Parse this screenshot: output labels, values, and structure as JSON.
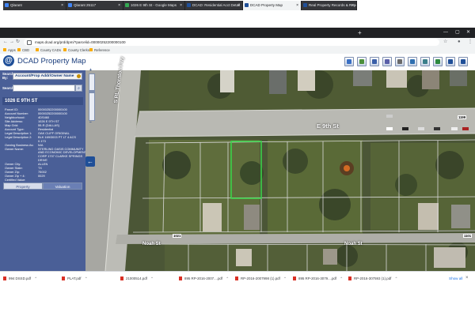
{
  "browser": {
    "tabs": [
      {
        "label": "Qlarant",
        "color": "#4285f4"
      },
      {
        "label": "Qlarant 25117",
        "color": "#4285f4"
      },
      {
        "label": "1026 E 9th St - Google Maps",
        "color": "#34a853"
      },
      {
        "label": "DCAD: Residential Acct Detail",
        "color": "#1f4f98"
      },
      {
        "label": "DCAD Property Map",
        "color": "#1f4f98"
      },
      {
        "label": "Real Property Records & Report",
        "color": "#1f4f98"
      }
    ],
    "new_tab_symbol": "+",
    "url": "maps.dcad.org/prd/dpm/?parcelid=00000252200000100",
    "bookmarks": [
      "Apps",
      "CBD",
      "County CADs",
      "County Clerks",
      "Reference"
    ]
  },
  "app": {
    "title": "DCAD Property Map",
    "tool_icons": [
      "zoom-icon",
      "map-icon",
      "bar-chart-icon",
      "layers-icon",
      "print-icon",
      "document-icon",
      "grid-icon",
      "pin-icon",
      "logo-small-icon",
      "help-icon"
    ]
  },
  "panel": {
    "search_by_label": "Search By:",
    "search_by_value": "Account/Prop Addr/Owner Name",
    "search_label": "Search",
    "property_title": "1026 E 9TH ST",
    "rows": [
      {
        "k": "Parcel ID:",
        "v": "00000252200000100"
      },
      {
        "k": "Account Number:",
        "v": "00000252200000100"
      },
      {
        "k": "Neighborhood:",
        "v": "4DS460"
      },
      {
        "k": "Site Address:",
        "v": "1026 E 9TH ST"
      },
      {
        "k": "Map Grid:",
        "v": "55-R (DALLAS)"
      },
      {
        "k": "Account Type:",
        "v": "Residential"
      },
      {
        "k": "Legal Description 1:",
        "v": "OAK CLIFF ORIGINAL"
      },
      {
        "k": "Legal Description 2:",
        "v": "BLK 169/3003 PT LT 4 ACS"
      },
      {
        "k": "",
        "v": "0.173"
      },
      {
        "k": "Owning Business As:",
        "v": "N/A"
      },
      {
        "k": "Owner Name:",
        "v": "STERLING OASIS COMMUNITY"
      },
      {
        "k": "",
        "v": "AND ECONOMIC DEVELOPMENT"
      },
      {
        "k": "",
        "v": "CORP 1707 CLARKE SPRINGS"
      },
      {
        "k": "",
        "v": "DRIVE"
      },
      {
        "k": "Owner City:",
        "v": "ALLEN"
      },
      {
        "k": "Owner State:",
        "v": "TX"
      },
      {
        "k": "Owner Zip:",
        "v": "75002"
      },
      {
        "k": "Owner Zip + 4:",
        "v": "0029"
      },
      {
        "k": "Certified Value:",
        "v": ""
      }
    ],
    "tab_property": "Property",
    "tab_valuation": "Valuation"
  },
  "map": {
    "zoom_plus": "+",
    "zoom_minus": "−",
    "streets": {
      "thornton": "S RL Thornton Fwy",
      "ninth": "E 9th St",
      "noah_left": "Noah St",
      "noah_right": "Noah St"
    },
    "numbers": {
      "n1199": "1199",
      "n1021": "1021",
      "n1101": "1101"
    }
  },
  "downloads": {
    "items": [
      "994 DSSD.pdf",
      "PLAT.pdf",
      "21000514.pdf",
      "895 RP-2016-2007....pdf",
      "RP-2016-2007998 (1).pdf",
      "895 RP-2016-3079....pdf",
      "RP-2016-307593 (1).pdf"
    ],
    "show_all": "Show all",
    "close": "×"
  }
}
